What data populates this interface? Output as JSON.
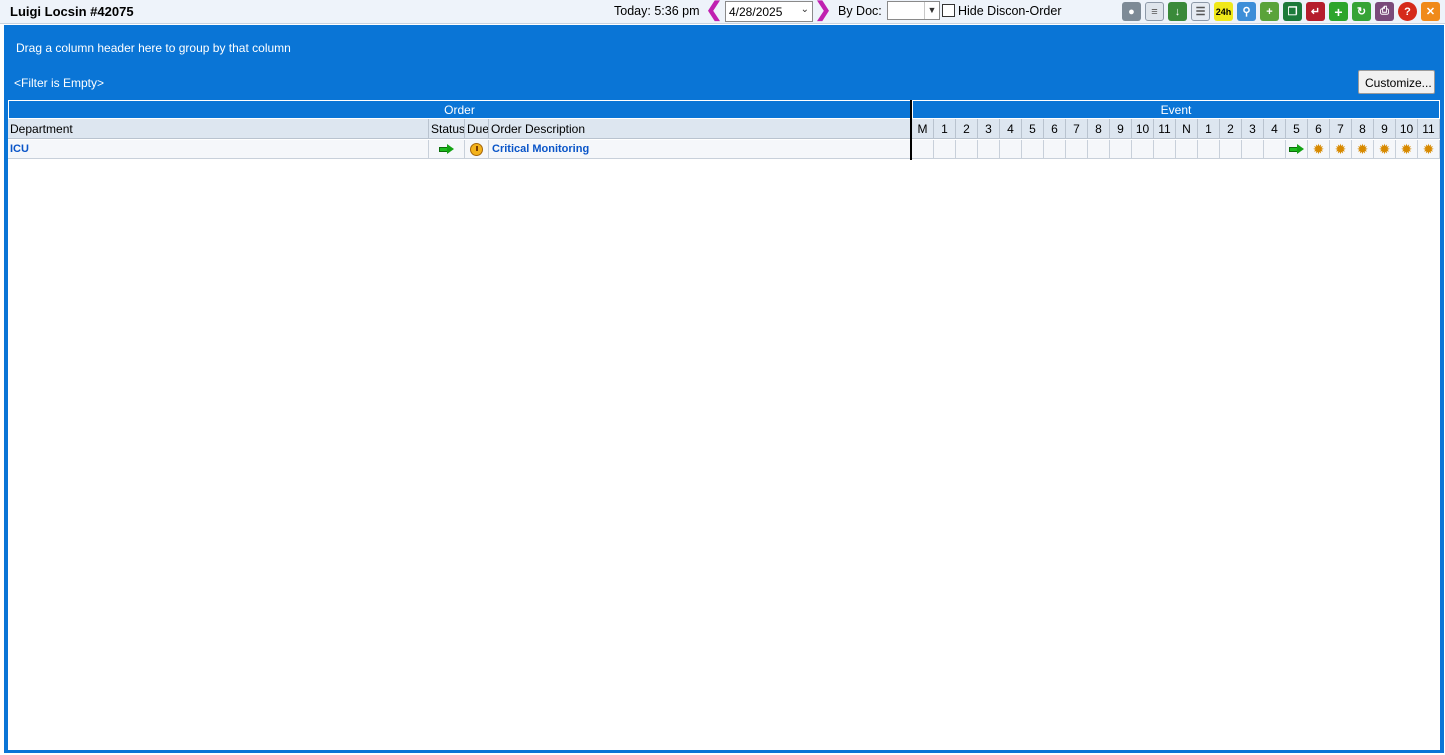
{
  "patient": {
    "name_id": "Luigi Locsin #42075"
  },
  "toolbar": {
    "today_label": "Today:",
    "today_time": "5:36 pm",
    "date_value": "4/28/2025",
    "bydoc_label": "By Doc:",
    "bydoc_value": "",
    "hide_discon_label": "Hide Discon-Order",
    "hide_discon_checked": false,
    "icons": [
      "doctor-icon",
      "list-icon",
      "import-icon",
      "document-icon",
      "24h-icon",
      "zoom-icon",
      "add-note-icon",
      "copy-icon",
      "exit-form-icon",
      "add-icon",
      "refresh-icon",
      "print-icon",
      "help-icon",
      "close-icon"
    ]
  },
  "grid": {
    "group_hint": "Drag a column header here to group by that column",
    "filter_text": "<Filter is Empty>",
    "customize_label": "Customize...",
    "band_order": "Order",
    "band_event": "Event",
    "columns": {
      "department": "Department",
      "status": "Status",
      "due": "Due",
      "description": "Order Description"
    },
    "hours": [
      "M",
      "1",
      "2",
      "3",
      "4",
      "5",
      "6",
      "7",
      "8",
      "9",
      "10",
      "11",
      "N",
      "1",
      "2",
      "3",
      "4",
      "5",
      "6",
      "7",
      "8",
      "9",
      "10",
      "11"
    ],
    "rows": [
      {
        "department": "ICU",
        "status_icon": "green-arrow-icon",
        "due_icon": "clock-icon",
        "description": "Critical Monitoring",
        "events": [
          "",
          "",
          "",
          "",
          "",
          "",
          "",
          "",
          "",
          "",
          "",
          "",
          "",
          "",
          "",
          "",
          "",
          "green-arrow-icon",
          "sun-icon",
          "sun-icon",
          "sun-icon",
          "sun-icon",
          "sun-icon",
          "sun-icon"
        ]
      }
    ]
  },
  "colors": {
    "frame_blue": "#0a75d6",
    "link_blue": "#0a55c8",
    "arrow_magenta": "#c021b0"
  }
}
